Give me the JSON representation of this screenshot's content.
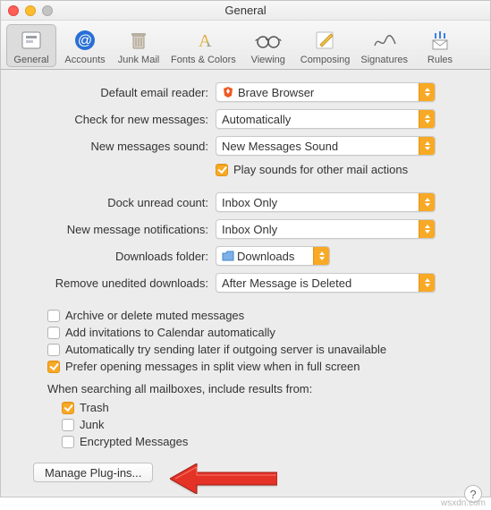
{
  "window": {
    "title": "General"
  },
  "toolbar": {
    "tabs": [
      {
        "label": "General"
      },
      {
        "label": "Accounts"
      },
      {
        "label": "Junk Mail"
      },
      {
        "label": "Fonts & Colors"
      },
      {
        "label": "Viewing"
      },
      {
        "label": "Composing"
      },
      {
        "label": "Signatures"
      },
      {
        "label": "Rules"
      }
    ]
  },
  "rows": {
    "default_reader": {
      "label": "Default email reader:",
      "value": "Brave Browser"
    },
    "check_messages": {
      "label": "Check for new messages:",
      "value": "Automatically"
    },
    "new_sound": {
      "label": "New messages sound:",
      "value": "New Messages Sound"
    },
    "play_sounds": {
      "label": "Play sounds for other mail actions"
    },
    "dock_unread": {
      "label": "Dock unread count:",
      "value": "Inbox Only"
    },
    "notifications": {
      "label": "New message notifications:",
      "value": "Inbox Only"
    },
    "downloads": {
      "label": "Downloads folder:",
      "value": "Downloads"
    },
    "remove_unedited": {
      "label": "Remove unedited downloads:",
      "value": "After Message is Deleted"
    }
  },
  "opts": {
    "archive_muted": {
      "label": "Archive or delete muted messages"
    },
    "add_invites": {
      "label": "Add invitations to Calendar automatically"
    },
    "auto_send_later": {
      "label": "Automatically try sending later if outgoing server is unavailable"
    },
    "split_view": {
      "label": "Prefer opening messages in split view when in full screen"
    }
  },
  "search_section": {
    "label": "When searching all mailboxes, include results from:",
    "trash": "Trash",
    "junk": "Junk",
    "encrypted": "Encrypted Messages"
  },
  "buttons": {
    "manage_plugins": "Manage Plug-ins..."
  },
  "watermark": "wsxdn.com"
}
